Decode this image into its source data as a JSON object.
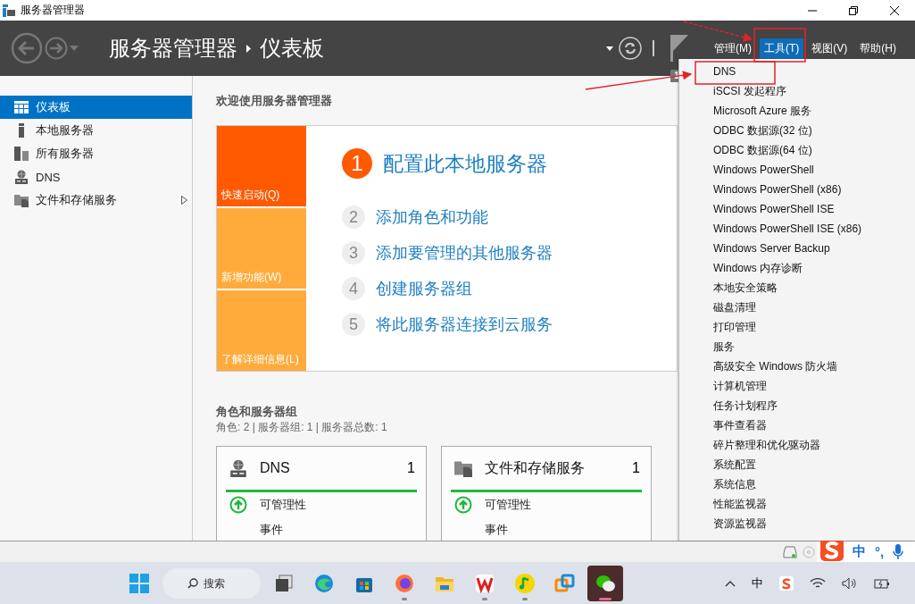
{
  "window": {
    "title": "服务器管理器"
  },
  "header": {
    "breadcrumb": [
      "服务器管理器",
      "仪表板"
    ],
    "notification_count": "1",
    "menus": [
      {
        "label": "管理(M)",
        "selected": false
      },
      {
        "label": "工具(T)",
        "selected": true
      },
      {
        "label": "视图(V)",
        "selected": false
      },
      {
        "label": "帮助(H)",
        "selected": false
      }
    ]
  },
  "sidebar": {
    "items": [
      {
        "label": "仪表板",
        "selected": true,
        "kind": "dashboard",
        "has_submenu": false
      },
      {
        "label": "本地服务器",
        "selected": false,
        "kind": "server",
        "has_submenu": false
      },
      {
        "label": "所有服务器",
        "selected": false,
        "kind": "servers",
        "has_submenu": false
      },
      {
        "label": "DNS",
        "selected": false,
        "kind": "dns",
        "has_submenu": false
      },
      {
        "label": "文件和存储服务",
        "selected": false,
        "kind": "files",
        "has_submenu": true
      }
    ]
  },
  "welcome": {
    "title": "欢迎使用服务器管理器",
    "tiles": [
      {
        "label": "快速启动(Q)",
        "color": "#ff5a00"
      },
      {
        "label": "新增功能(W)",
        "color": "#ffab3c"
      },
      {
        "label": "了解详细信息(L)",
        "color": "#ffab3c"
      }
    ],
    "steps": [
      {
        "number": "1",
        "label": "配置此本地服务器",
        "primary": true
      },
      {
        "number": "2",
        "label": "添加角色和功能",
        "primary": false
      },
      {
        "number": "3",
        "label": "添加要管理的其他服务器",
        "primary": false
      },
      {
        "number": "4",
        "label": "创建服务器组",
        "primary": false
      },
      {
        "number": "5",
        "label": "将此服务器连接到云服务",
        "primary": false
      }
    ]
  },
  "roles": {
    "title": "角色和服务器组",
    "summary": "角色: 2 | 服务器组: 1 | 服务器总数: 1",
    "cards": [
      {
        "kind": "dns",
        "name": "DNS",
        "count": "1",
        "rows": [
          {
            "label": "可管理性",
            "kind": "health"
          },
          {
            "label": "事件",
            "kind": "plain"
          }
        ]
      },
      {
        "kind": "files",
        "name": "文件和存储服务",
        "count": "1",
        "rows": [
          {
            "label": "可管理性",
            "kind": "health"
          },
          {
            "label": "事件",
            "kind": "plain"
          }
        ]
      }
    ]
  },
  "tools_menu": {
    "items": [
      "DNS",
      "iSCSI 发起程序",
      "Microsoft Azure 服务",
      "ODBC 数据源(32 位)",
      "ODBC 数据源(64 位)",
      "Windows PowerShell",
      "Windows PowerShell (x86)",
      "Windows PowerShell ISE",
      "Windows PowerShell ISE (x86)",
      "Windows Server Backup",
      "Windows 内存诊断",
      "本地安全策略",
      "磁盘清理",
      "打印管理",
      "服务",
      "高级安全 Windows 防火墙",
      "计算机管理",
      "任务计划程序",
      "事件查看器",
      "碎片整理和优化驱动器",
      "系统配置",
      "系统信息",
      "性能监视器",
      "资源监视器"
    ]
  },
  "ime_bar": {
    "mode": "中",
    "punctuation": "°,"
  },
  "taskbar": {
    "search": "搜索",
    "tray_language": "中",
    "apps": [
      {
        "kind": "taskview",
        "running": false,
        "selected": false
      },
      {
        "kind": "edge",
        "running": false,
        "selected": false
      },
      {
        "kind": "store",
        "running": false,
        "selected": false
      },
      {
        "kind": "firefox",
        "running": true,
        "selected": false
      },
      {
        "kind": "folder",
        "running": false,
        "selected": false
      },
      {
        "kind": "wps",
        "running": true,
        "selected": false
      },
      {
        "kind": "music",
        "running": true,
        "selected": false
      },
      {
        "kind": "vm",
        "running": false,
        "selected": false
      },
      {
        "kind": "chat",
        "running": true,
        "selected": true
      }
    ]
  }
}
